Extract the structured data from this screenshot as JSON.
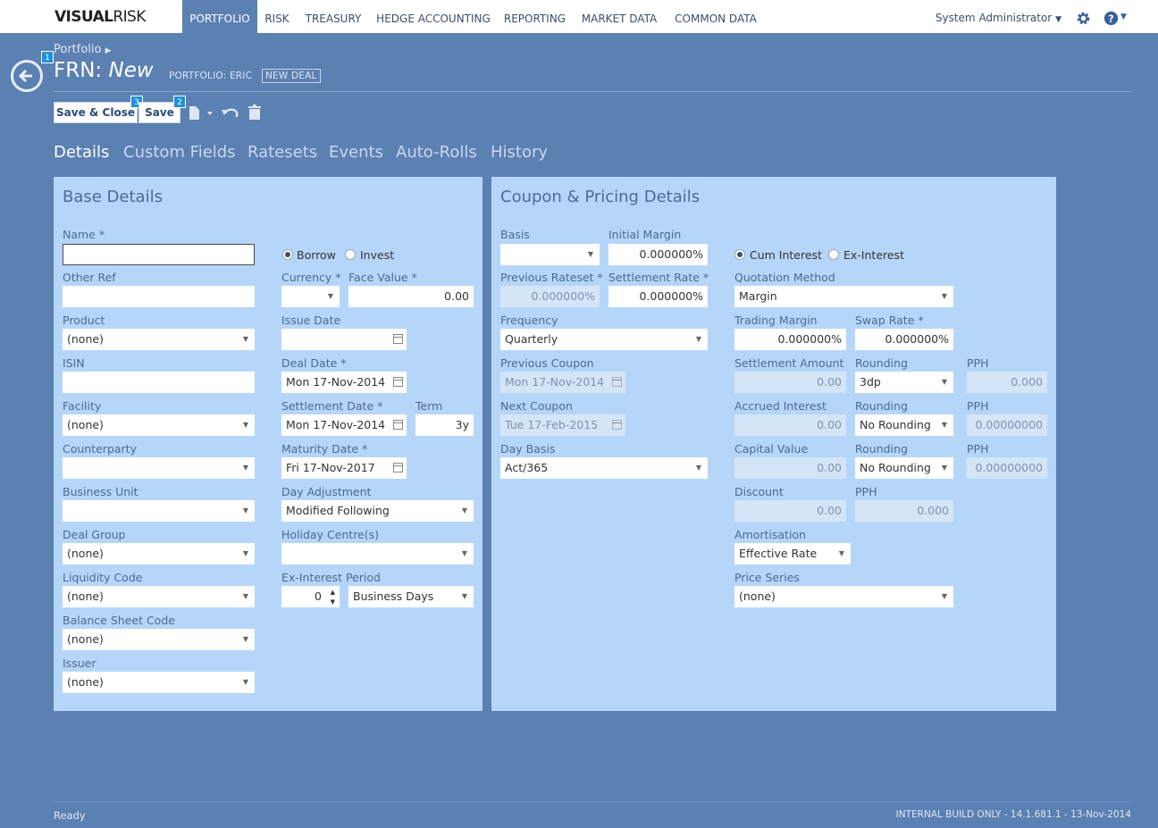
{
  "app": {
    "logo_bold": "VISUAL",
    "logo_light": "RISK"
  },
  "nav": [
    "PORTFOLIO",
    "RISK",
    "TREASURY",
    "HEDGE ACCOUNTING",
    "REPORTING",
    "MARKET DATA",
    "COMMON DATA"
  ],
  "user": {
    "name": "System Administrator"
  },
  "breadcrumb": "Portfolio",
  "title": {
    "prefix": "FRN:",
    "name": "New"
  },
  "portfolio_label": "PORTFOLIO: ERIC",
  "new_deal_badge": "NEW DEAL",
  "badges": {
    "back": "1",
    "save": "2",
    "save_close": "3"
  },
  "toolbar": {
    "save_close": "Save & Close",
    "save": "Save"
  },
  "tabs": [
    "Details",
    "Custom Fields",
    "Ratesets",
    "Events",
    "Auto-Rolls",
    "History"
  ],
  "base": {
    "title": "Base Details",
    "name_label": "Name *",
    "name_value": "",
    "borrow": "Borrow",
    "invest": "Invest",
    "other_ref_label": "Other Ref",
    "other_ref_value": "",
    "currency_label": "Currency *",
    "currency_value": "",
    "face_value_label": "Face Value *",
    "face_value": "0.00",
    "product_label": "Product",
    "product_value": "(none)",
    "issue_date_label": "Issue Date",
    "issue_date": "",
    "isin_label": "ISIN",
    "isin_value": "",
    "deal_date_label": "Deal Date *",
    "deal_date": "Mon 17-Nov-2014",
    "facility_label": "Facility",
    "facility_value": "(none)",
    "settlement_date_label": "Settlement Date *",
    "settlement_date": "Mon 17-Nov-2014",
    "term_label": "Term",
    "term_value": "3y",
    "counterparty_label": "Counterparty",
    "counterparty_value": "",
    "maturity_date_label": "Maturity Date *",
    "maturity_date": "Fri 17-Nov-2017",
    "business_unit_label": "Business Unit",
    "business_unit_value": "",
    "day_adjustment_label": "Day Adjustment",
    "day_adjustment_value": "Modified Following",
    "deal_group_label": "Deal Group",
    "deal_group_value": "(none)",
    "holiday_centre_label": "Holiday Centre(s)",
    "holiday_centre_value": "",
    "liquidity_code_label": "Liquidity Code",
    "liquidity_code_value": "(none)",
    "ex_interest_period_label": "Ex-Interest Period",
    "ex_interest_period_value": "0",
    "ex_interest_period_unit": "Business Days",
    "balance_sheet_code_label": "Balance Sheet Code",
    "balance_sheet_code_value": "(none)",
    "issuer_label": "Issuer",
    "issuer_value": "(none)"
  },
  "coupon": {
    "title": "Coupon & Pricing Details",
    "basis_label": "Basis",
    "basis_value": "",
    "initial_margin_label": "Initial Margin",
    "initial_margin": "0.000000%",
    "cum_interest": "Cum Interest",
    "ex_interest": "Ex-Interest",
    "prev_rateset_label": "Previous Rateset *",
    "prev_rateset": "0.000000%",
    "settlement_rate_label": "Settlement Rate *",
    "settlement_rate": "0.000000%",
    "quotation_method_label": "Quotation Method",
    "quotation_method": "Margin",
    "frequency_label": "Frequency",
    "frequency": "Quarterly",
    "trading_margin_label": "Trading Margin",
    "trading_margin": "0.000000%",
    "swap_rate_label": "Swap Rate *",
    "swap_rate": "0.000000%",
    "prev_coupon_label": "Previous Coupon",
    "prev_coupon": "Mon 17-Nov-2014",
    "settlement_amount_label": "Settlement Amount",
    "settlement_amount": "0.00",
    "rounding_label": "Rounding",
    "rounding_1": "3dp",
    "rounding_2": "No Rounding",
    "rounding_3": "No Rounding",
    "pph_label": "PPH",
    "pph_1": "0.000",
    "pph_2": "0.00000000",
    "pph_3": "0.00000000",
    "pph_4": "0.000",
    "next_coupon_label": "Next Coupon",
    "next_coupon": "Tue 17-Feb-2015",
    "accrued_interest_label": "Accrued Interest",
    "accrued_interest": "0.00",
    "day_basis_label": "Day Basis",
    "day_basis": "Act/365",
    "capital_value_label": "Capital Value",
    "capital_value": "0.00",
    "discount_label": "Discount",
    "discount": "0.00",
    "amortisation_label": "Amortisation",
    "amortisation": "Effective Rate",
    "price_series_label": "Price Series",
    "price_series": "(none)"
  },
  "status": {
    "left": "Ready",
    "right": "INTERNAL BUILD ONLY - 14.1.681.1 - 13-Nov-2014"
  }
}
